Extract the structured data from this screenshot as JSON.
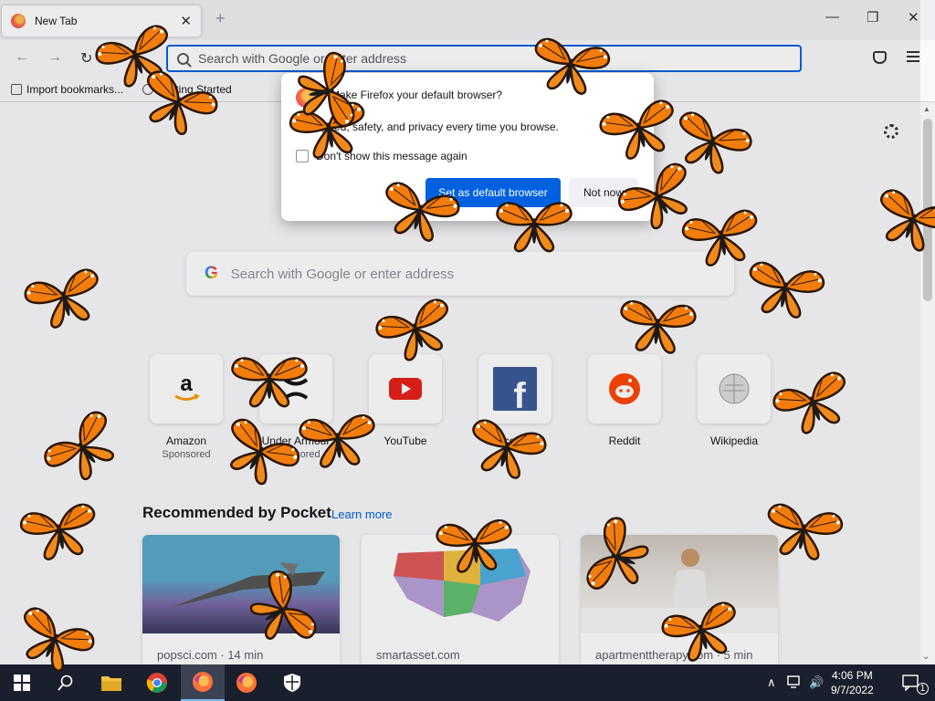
{
  "tab": {
    "title": "New Tab",
    "close": "✕"
  },
  "window": {
    "new_tab": "+",
    "minimize": "—",
    "restore": "❐",
    "close": "✕"
  },
  "nav": {
    "back": "←",
    "forward": "→",
    "reload": "↻",
    "url_placeholder": "Search with Google or enter address"
  },
  "bookmarks": [
    {
      "label": "Import bookmarks..."
    },
    {
      "label": "Getting Started"
    }
  ],
  "search": {
    "placeholder": "Search with Google or enter address",
    "logo": "G"
  },
  "top_sites": [
    {
      "label": "Amazon",
      "sponsored": "Sponsored",
      "icon": "amazon-icon"
    },
    {
      "label": "Under Armour",
      "sponsored": "Sponsored",
      "icon": "under-armour-icon"
    },
    {
      "label": "YouTube",
      "sponsored": "",
      "icon": "youtube-icon"
    },
    {
      "label": "Facebook",
      "sponsored": "",
      "icon": "facebook-icon"
    },
    {
      "label": "Reddit",
      "sponsored": "",
      "icon": "reddit-icon"
    },
    {
      "label": "Wikipedia",
      "sponsored": "",
      "icon": "wikipedia-icon"
    }
  ],
  "pocket": {
    "title": "Recommended by Pocket",
    "learn_more": "Learn more",
    "cards": [
      {
        "source": "popsci.com · 14 min"
      },
      {
        "source": "smartasset.com"
      },
      {
        "source": "apartmenttherapy.com · 5 min"
      }
    ]
  },
  "dialog": {
    "title": "Make Firefox your default browser?",
    "body": "Get speed, safety, and privacy every time you browse.",
    "checkbox": "Don't show this message again",
    "primary": "Set as default browser",
    "secondary": "Not now"
  },
  "taskbar": {
    "time": "4:06 PM",
    "date": "9/7/2022",
    "notifications": "1",
    "tray_chevron": "∧",
    "volume": "🔊"
  },
  "colors": {
    "accent": "#0061e0",
    "taskbar": "#1a1f2d",
    "butterfly": "#f27d0c"
  }
}
